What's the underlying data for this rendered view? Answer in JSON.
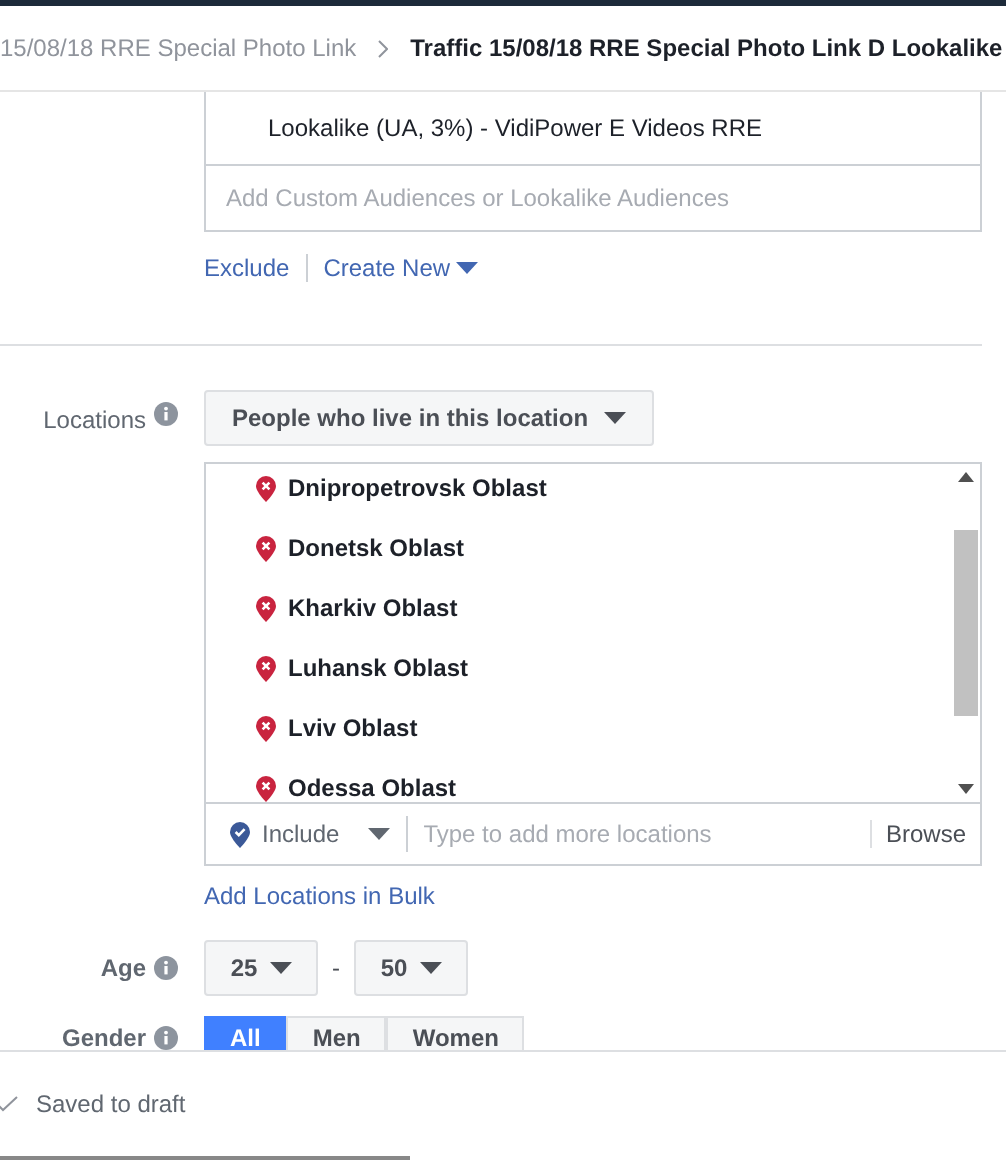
{
  "breadcrumb": [
    {
      "label": "15/08/18 RRE Special Photo Link",
      "current": false
    },
    {
      "label": "Traffic 15/08/18 RRE Special Photo Link D Lookalike",
      "current": true
    }
  ],
  "audiences": {
    "items": [
      "Lookalike (UA, 3%) - VidiPower E Videos RRE"
    ],
    "placeholder": "Add Custom Audiences or Lookalike Audiences",
    "links": [
      "Exclude",
      "Create New"
    ]
  },
  "locations": {
    "label": "Locations",
    "mode": "People who live in this location",
    "items": [
      "Dnipropetrovsk Oblast",
      "Donetsk Oblast",
      "Kharkiv Oblast",
      "Luhansk Oblast",
      "Lviv Oblast",
      "Odessa Oblast"
    ],
    "include": "Include",
    "placeholder": "Type to add more locations",
    "browse": "Browse",
    "bulk_link": "Add Locations in Bulk"
  },
  "age": {
    "label": "Age",
    "min": "25",
    "separator": "-",
    "max": "50"
  },
  "gender": {
    "label": "Gender",
    "options": [
      {
        "label": "All",
        "selected": true
      },
      {
        "label": "Men",
        "selected": false
      },
      {
        "label": "Women",
        "selected": false
      }
    ]
  },
  "footer": {
    "status": "Saved to draft"
  }
}
